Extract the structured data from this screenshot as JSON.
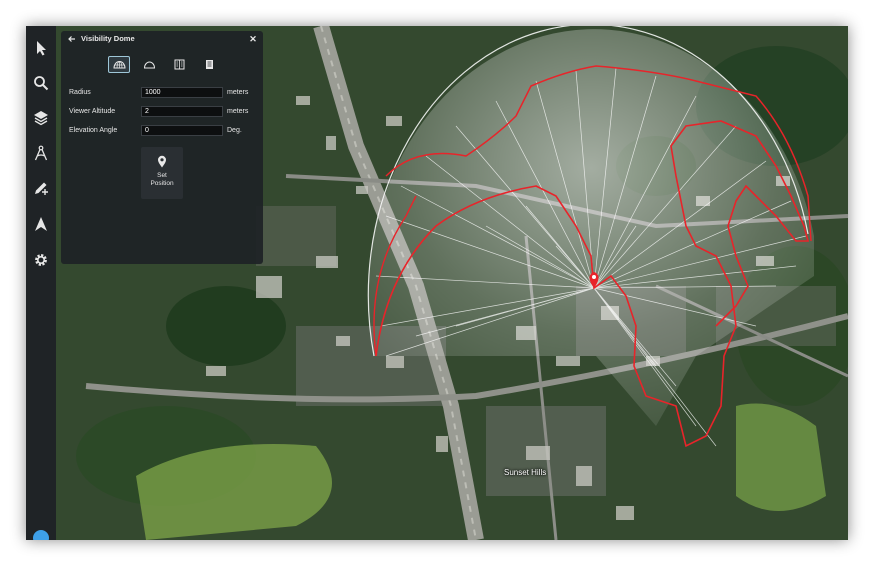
{
  "panel": {
    "title": "Visibility Dome",
    "modes": [
      {
        "icon": "dome-icon",
        "active": true
      },
      {
        "icon": "half-dome-icon",
        "active": false
      },
      {
        "icon": "building-icon",
        "active": false
      },
      {
        "icon": "building-alt-icon",
        "active": false
      }
    ],
    "fields": [
      {
        "label": "Radius",
        "value": "1000",
        "unit": "meters"
      },
      {
        "label": "Viewer Altitude",
        "value": "2",
        "unit": "meters"
      },
      {
        "label": "Elevation Angle",
        "value": "0",
        "unit": "Deg."
      }
    ],
    "set_position_label": "Set\nPosition"
  },
  "toolbar": {
    "tools": [
      "pointer-icon",
      "search-icon",
      "layers-icon",
      "measure-icon",
      "draw-icon",
      "navigate-icon",
      "settings-icon"
    ]
  },
  "map": {
    "place_label": "Sunset Hills"
  },
  "colors": {
    "visible_boundary": "#e8242a",
    "panel_bg": "#1e2226",
    "active_mode_border": "#9ec7d8"
  }
}
